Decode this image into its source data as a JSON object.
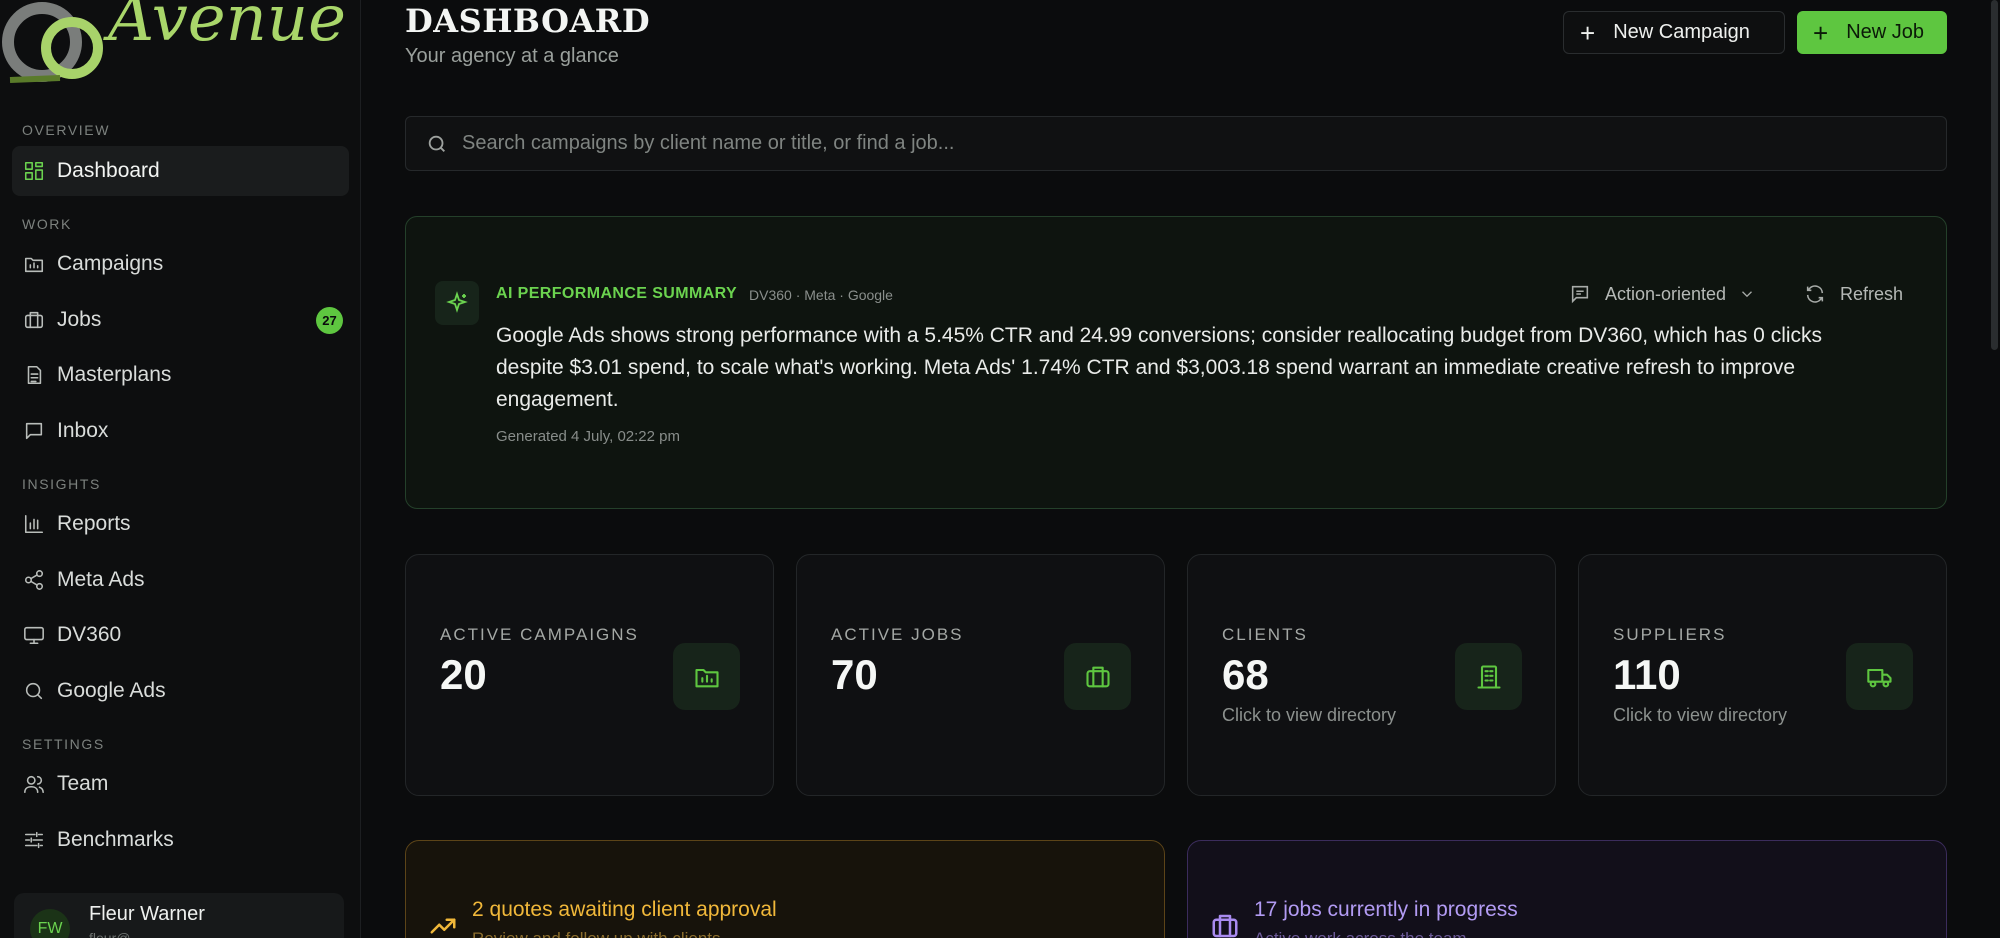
{
  "brand": {
    "name": "Avenue"
  },
  "sidebar": {
    "sections": [
      {
        "label": "OVERVIEW"
      },
      {
        "label": "WORK"
      },
      {
        "label": "INSIGHTS"
      },
      {
        "label": "SETTINGS"
      }
    ],
    "items": [
      {
        "label": "Dashboard",
        "icon": "grid-icon",
        "active": true
      },
      {
        "label": "Campaigns",
        "icon": "folder-chart-icon"
      },
      {
        "label": "Jobs",
        "icon": "briefcase-icon",
        "badge": "27"
      },
      {
        "label": "Masterplans",
        "icon": "document-icon"
      },
      {
        "label": "Inbox",
        "icon": "message-icon"
      },
      {
        "label": "Reports",
        "icon": "bar-chart-icon"
      },
      {
        "label": "Meta Ads",
        "icon": "share-icon"
      },
      {
        "label": "DV360",
        "icon": "monitor-icon"
      },
      {
        "label": "Google Ads",
        "icon": "search-icon"
      },
      {
        "label": "Team",
        "icon": "users-icon"
      },
      {
        "label": "Benchmarks",
        "icon": "sliders-icon"
      }
    ],
    "user": {
      "initials": "FW",
      "name": "Fleur Warner",
      "email": "fleur@..."
    }
  },
  "header": {
    "title": "DASHBOARD",
    "subtitle": "Your agency at a glance",
    "new_campaign_label": "New Campaign",
    "new_job_label": "New Job"
  },
  "search": {
    "placeholder": "Search campaigns by client name or title, or find a job...",
    "value": ""
  },
  "ai_summary": {
    "label": "AI PERFORMANCE SUMMARY",
    "sources": "DV360 · Meta · Google",
    "tone": "Action-oriented",
    "refresh_label": "Refresh",
    "text": "Google Ads shows strong performance with a 5.45% CTR and 24.99 conversions; consider reallocating budget from DV360, which has 0 clicks despite $3.01 spend, to scale what's working. Meta Ads' 1.74% CTR and $3,003.18 spend warrant an immediate creative refresh to improve engagement.",
    "generated": "Generated 4 July, 02:22 pm"
  },
  "stats": [
    {
      "label": "ACTIVE CAMPAIGNS",
      "value": "20",
      "sub": "",
      "icon": "folder-chart-icon"
    },
    {
      "label": "ACTIVE JOBS",
      "value": "70",
      "sub": "",
      "icon": "briefcase-icon"
    },
    {
      "label": "CLIENTS",
      "value": "68",
      "sub": "Click to view directory",
      "icon": "building-icon"
    },
    {
      "label": "SUPPLIERS",
      "value": "110",
      "sub": "Click to view directory",
      "icon": "truck-icon"
    }
  ],
  "alerts": [
    {
      "title": "2 quotes awaiting client approval",
      "sub": "Review and follow up with clients",
      "icon": "trending-up-icon",
      "color": "#f1b83a"
    },
    {
      "title": "17 jobs currently in progress",
      "sub": "Active work across the team",
      "icon": "briefcase-icon",
      "color": "#a98bf0"
    }
  ],
  "colors": {
    "accent": "#5ec640",
    "amber": "#f1b83a",
    "purple": "#a98bf0"
  }
}
